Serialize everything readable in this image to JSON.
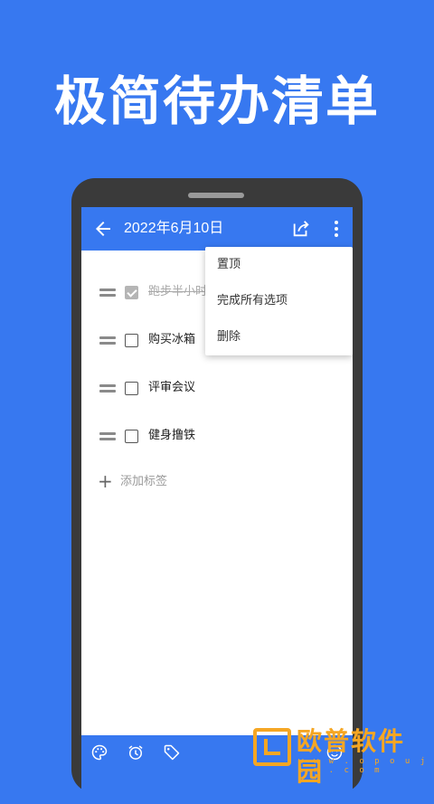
{
  "headline": "极简待办清单",
  "appbar": {
    "title": "2022年6月10日",
    "back_icon": "arrow-left-icon",
    "share_icon": "share-icon",
    "more_icon": "more-vert-icon"
  },
  "todos": [
    {
      "label": "跑步半小时",
      "checked": true
    },
    {
      "label": "购买冰箱",
      "checked": false
    },
    {
      "label": "评审会议",
      "checked": false
    },
    {
      "label": "健身撸铁",
      "checked": false
    }
  ],
  "add_tag": {
    "label": "添加标签"
  },
  "menu": {
    "items": [
      "置顶",
      "完成所有选项",
      "删除"
    ]
  },
  "bottombar": {
    "icons": [
      "palette-icon",
      "alarm-icon",
      "tag-icon",
      "emoji-icon"
    ]
  },
  "watermark": {
    "name": "欧普软件园",
    "url": "w w w . o p o u j i n . c o m"
  },
  "colors": {
    "primary": "#3778f0",
    "phone_frame": "#3a3a3a",
    "watermark": "#f5a623"
  }
}
